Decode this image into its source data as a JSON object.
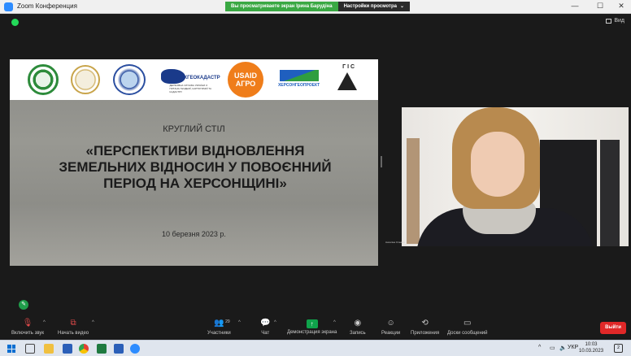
{
  "window": {
    "title": "Zoom Конференция",
    "share_banner": "Вы просматриваете экран Ірина Барудіна",
    "view_options": "Настройки просмотра",
    "view_options_caret": "⌄",
    "controls": {
      "minimize": "—",
      "maximize": "☐",
      "close": "✕"
    }
  },
  "meeting": {
    "view_label": "Вид"
  },
  "slide": {
    "logos": [
      "logo-1",
      "logo-2",
      "logo-3",
      "ДЕРЖГЕОКАДАСТР",
      "USAID АГРО",
      "ХЕРСОНГЕОПРОЕКТ",
      "ГІС"
    ],
    "kicker": "КРУГЛИЙ СТІЛ",
    "title": "«ПЕРСПЕКТИВИ ВІДНОВЛЕННЯ ЗЕМЕЛЬНИХ ВІДНОСИН У ПОВОЄННИЙ ПЕРІОД НА ХЕРСОНЩИНІ»",
    "date": "10 березня 2023 р.",
    "usaid_line1": "USAID",
    "usaid_line2": "АГРО",
    "derzh_sub": "ДЕРЖАВНА СЛУЖБА УКРАЇНИ З ПИТАНЬ ГЕОДЕЗІЇ, КАРТОГРАФІЇ ТА КАДАСТРУ",
    "gis": "Г І С"
  },
  "video": {
    "participant_name": "Ангеліна Станіна"
  },
  "toolbar": {
    "mute_label": "Включить звук",
    "video_label": "Начать видео",
    "participants_label": "Участники",
    "participants_count": "29",
    "chat_label": "Чат",
    "share_label": "Демонстрация экрана",
    "record_label": "Запись",
    "reactions_label": "Реакции",
    "apps_label": "Приложения",
    "whiteboard_label": "Доски сообщений",
    "leave_label": "Выйти"
  },
  "taskbar": {
    "language": "УКР",
    "time": "10:03",
    "date": "10.03.2023",
    "notifications": "2"
  },
  "colors": {
    "accent_green": "#3aa843",
    "leave_red": "#e02828",
    "zoom_blue": "#2d8cff",
    "usaid_orange": "#ef7d1a"
  }
}
